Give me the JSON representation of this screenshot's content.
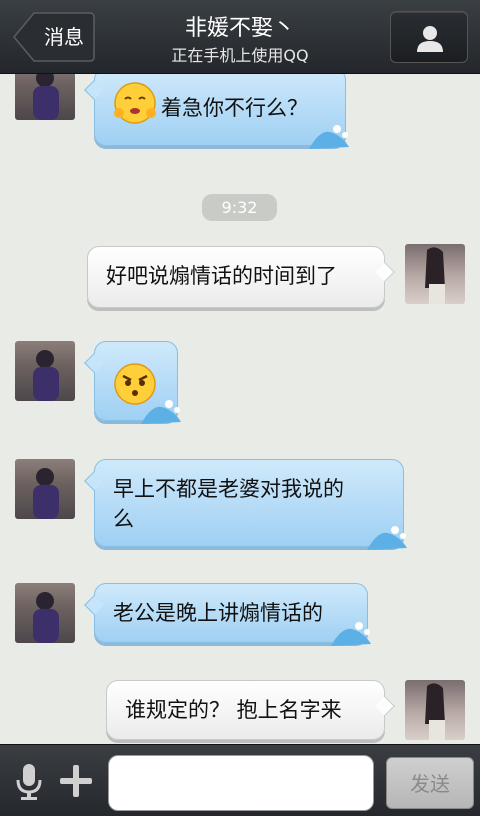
{
  "header": {
    "back_label": "消息",
    "contact_name": "非媛不娶丶",
    "status": "正在手机上使用QQ"
  },
  "chat": {
    "time_divider": "9:32",
    "messages": [
      {
        "side": "left",
        "text": "着急你不行么？",
        "emoji": "anxious-emoji"
      },
      {
        "side": "right",
        "text": "好吧说煽情话的时间到了"
      },
      {
        "side": "left",
        "text": "",
        "emoji": "angry-emoji"
      },
      {
        "side": "left",
        "text": "早上不都是老婆对我说的\n么"
      },
      {
        "side": "left",
        "text": "老公是晚上讲煽情话的"
      },
      {
        "side": "right",
        "text": "谁规定的？ 抱上名字来"
      }
    ]
  },
  "footer": {
    "input_value": "",
    "send_label": "发送"
  },
  "icons": [
    "back-arrow-icon",
    "profile-icon",
    "microphone-icon",
    "plus-icon",
    "wave-icon"
  ],
  "colors": {
    "header": "#2b2f33",
    "blue_bubble": "#b6dcf6",
    "white_bubble": "#f6f6f6",
    "background": "#e9ebe6"
  }
}
